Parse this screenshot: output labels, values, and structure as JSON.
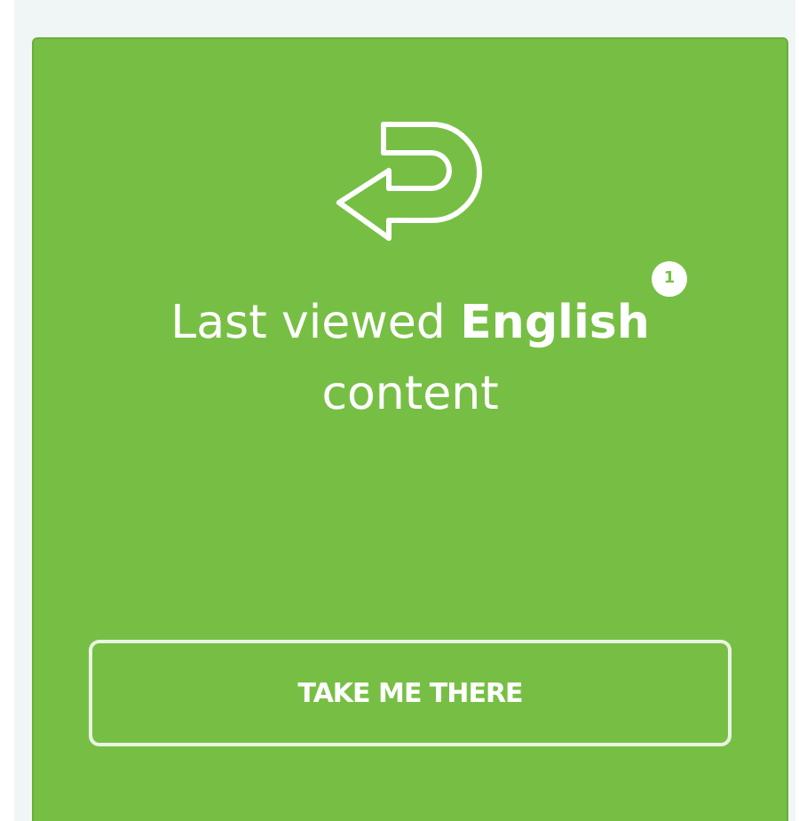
{
  "card": {
    "notification_count": "1",
    "message": "Last viewed **English** content",
    "button": "TAKE ME THERE"
  }
}
